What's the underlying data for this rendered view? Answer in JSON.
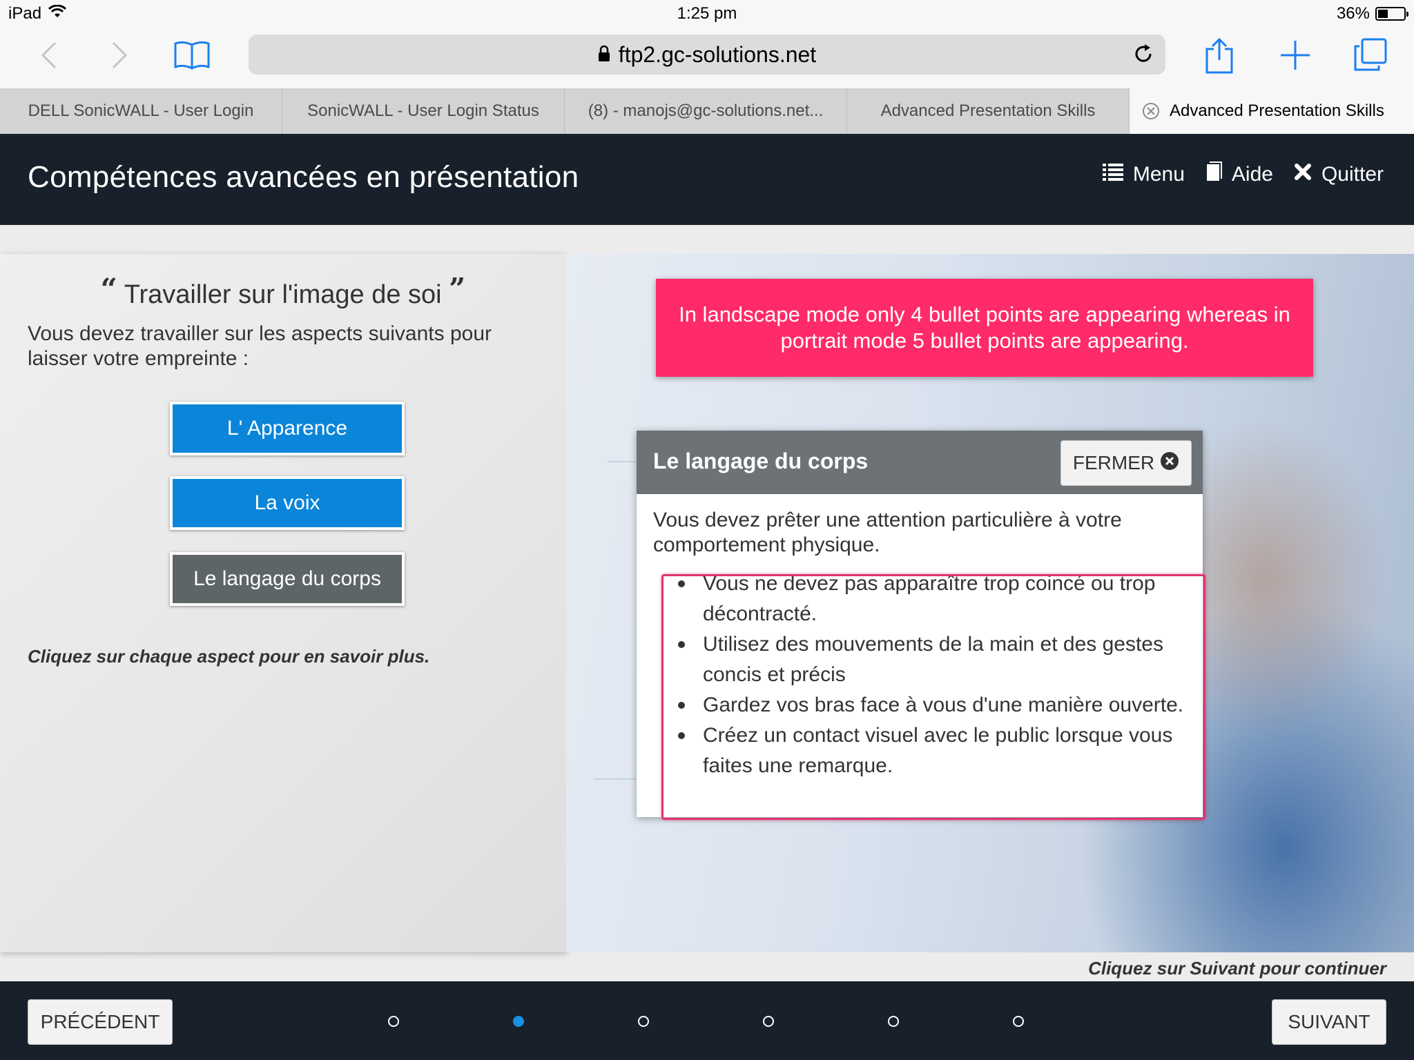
{
  "status_bar": {
    "device": "iPad",
    "time": "1:25 pm",
    "battery": "36%",
    "battery_level": 0.36
  },
  "browser": {
    "url": "ftp2.gc-solutions.net",
    "tabs": [
      {
        "label": "DELL SonicWALL - User Login"
      },
      {
        "label": "SonicWALL - User Login Status"
      },
      {
        "label": "(8) - manojs@gc-solutions.net..."
      },
      {
        "label": "Advanced Presentation Skills"
      },
      {
        "label": "Advanced Presentation Skills",
        "active": true
      }
    ]
  },
  "course": {
    "title": "Compétences avancées en présentation",
    "nav": {
      "menu": "Menu",
      "help": "Aide",
      "quit": "Quitter"
    }
  },
  "left_panel": {
    "heading": "Travailler sur l'image de soi",
    "intro": "Vous devez travailler sur les aspects suivants pour laisser votre empreinte :",
    "buttons": [
      {
        "label": "L' Apparence",
        "state": "blue"
      },
      {
        "label": "La voix",
        "state": "blue"
      },
      {
        "label": "Le langage du corps",
        "state": "selected"
      }
    ],
    "hint": "Cliquez sur chaque aspect pour en savoir plus."
  },
  "annotation": {
    "text": "In landscape mode only 4 bullet points are appearing whereas in portrait mode 5 bullet points are appearing.",
    "color": "#ff2b68"
  },
  "popup": {
    "title": "Le langage du corps",
    "close_label": "FERMER",
    "intro": "Vous devez prêter une attention particulière à votre comportement physique.",
    "bullets": [
      "Vous ne devez pas apparaître trop coincé ou trop décontracté.",
      "Utilisez des mouvements de la main et des gestes concis et précis",
      "Gardez vos bras face à vous d'une manière ouverte.",
      "Créez un contact visuel avec le public lorsque vous faites une remarque."
    ]
  },
  "continue_hint": "Cliquez sur Suivant pour continuer",
  "footer": {
    "prev": "PRÉCÉDENT",
    "next": "SUIVANT",
    "pages": 6,
    "current_page": 2
  },
  "colors": {
    "header_bg": "#17202b",
    "button_blue": "#0a85d9",
    "button_grey": "#5e6566",
    "accent_dot": "#1a8fe3"
  }
}
